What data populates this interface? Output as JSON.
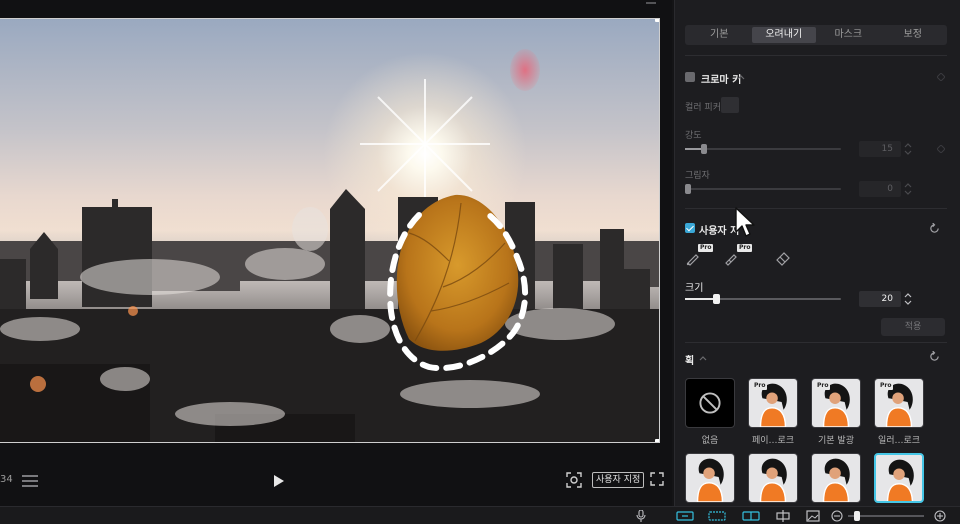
{
  "player": {
    "timecode": "34",
    "ratio_label": "사용자 지정"
  },
  "panel": {
    "top_tabs": [
      "",
      "",
      "",
      "",
      ""
    ],
    "sub_tabs": [
      {
        "label": "기본",
        "active": false
      },
      {
        "label": "오려내기",
        "active": true
      },
      {
        "label": "마스크",
        "active": false
      },
      {
        "label": "보정",
        "active": false
      }
    ],
    "chroma_key": {
      "title": "크로마 키",
      "checked": false,
      "color_picker_label": "컬러 피커",
      "strength_label": "강도",
      "strength_value": "15",
      "strength_level": 0.12,
      "shadow_label": "그림자",
      "shadow_value": "0",
      "shadow_level": 0.0
    },
    "custom_cutout": {
      "title": "사용자 지",
      "checked": true,
      "pro_badge": "Pro",
      "size_label": "크기",
      "size_value": "20",
      "size_level": 0.2,
      "apply_label": "적용"
    },
    "stroke": {
      "title": "획",
      "items": [
        {
          "label": "없음",
          "type": "none",
          "selected": false
        },
        {
          "label": "페이…로크",
          "type": "pro",
          "selected": false
        },
        {
          "label": "기본 발광",
          "type": "pro",
          "selected": false
        },
        {
          "label": "일러…로크",
          "type": "pro",
          "selected": false
        },
        {
          "label": "",
          "type": "plain",
          "selected": false
        },
        {
          "label": "",
          "type": "plain",
          "selected": false
        },
        {
          "label": "",
          "type": "plain",
          "selected": false
        },
        {
          "label": "",
          "type": "plain",
          "selected": true
        }
      ]
    }
  },
  "bottom_bar": {
    "zoom_level": 0.12
  },
  "colors": {
    "accent": "#35c1e0",
    "checkbox_on": "#3aa7d6",
    "selected_border": "#45c6e6"
  },
  "icons": [
    "play-icon",
    "list-view-icon",
    "screenshot-icon",
    "fullscreen-icon",
    "reset-icon",
    "keyframe-icon",
    "brush-icon",
    "eraser-icon",
    "no-stroke-icon",
    "microphone-icon",
    "zoom-out-icon",
    "zoom-in-icon",
    "mouse-cursor"
  ]
}
